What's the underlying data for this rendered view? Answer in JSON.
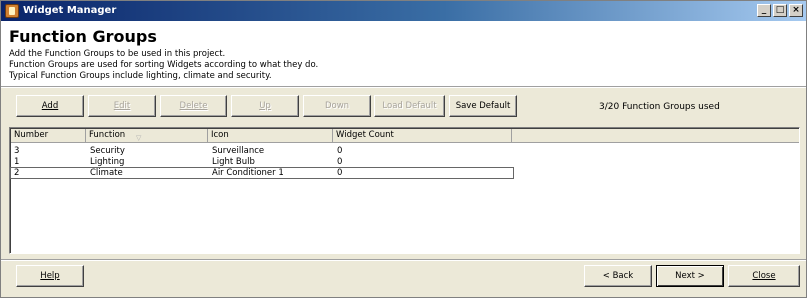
{
  "window": {
    "title": "Widget Manager",
    "min_label": "_",
    "max_label": "□",
    "close_label": "×"
  },
  "header": {
    "heading": "Function Groups",
    "desc1": "Add the Function Groups to be used in this project.",
    "desc2": "Function Groups are used for sorting Widgets according to what they do.",
    "desc3": "Typical Function Groups include lighting, climate and security."
  },
  "toolbar": {
    "add": "Add",
    "edit": "Edit",
    "delete": "Delete",
    "up": "Up",
    "down": "Down",
    "load_default": "Load Default",
    "save_default": "Save Default"
  },
  "status": "3/20 Function Groups used",
  "grid": {
    "columns": [
      "Number",
      "Function",
      "Icon",
      "Widget Count"
    ],
    "rows": [
      {
        "number": "3",
        "function": "Security",
        "icon": "Surveillance",
        "count": "0"
      },
      {
        "number": "1",
        "function": "Lighting",
        "icon": "Light Bulb",
        "count": "0"
      },
      {
        "number": "2",
        "function": "Climate",
        "icon": "Air Conditioner 1",
        "count": "0"
      }
    ],
    "selected_row": 2
  },
  "footer": {
    "help": "Help",
    "back": "< Back",
    "next": "Next >",
    "close": "Close"
  },
  "icons": {
    "app": "widget-manager-app-icon",
    "sort": "sort-indicator-icon"
  },
  "colors": {
    "titlebar_start": "#0a246a",
    "titlebar_end": "#a6caf0",
    "face": "#ece9d8"
  }
}
